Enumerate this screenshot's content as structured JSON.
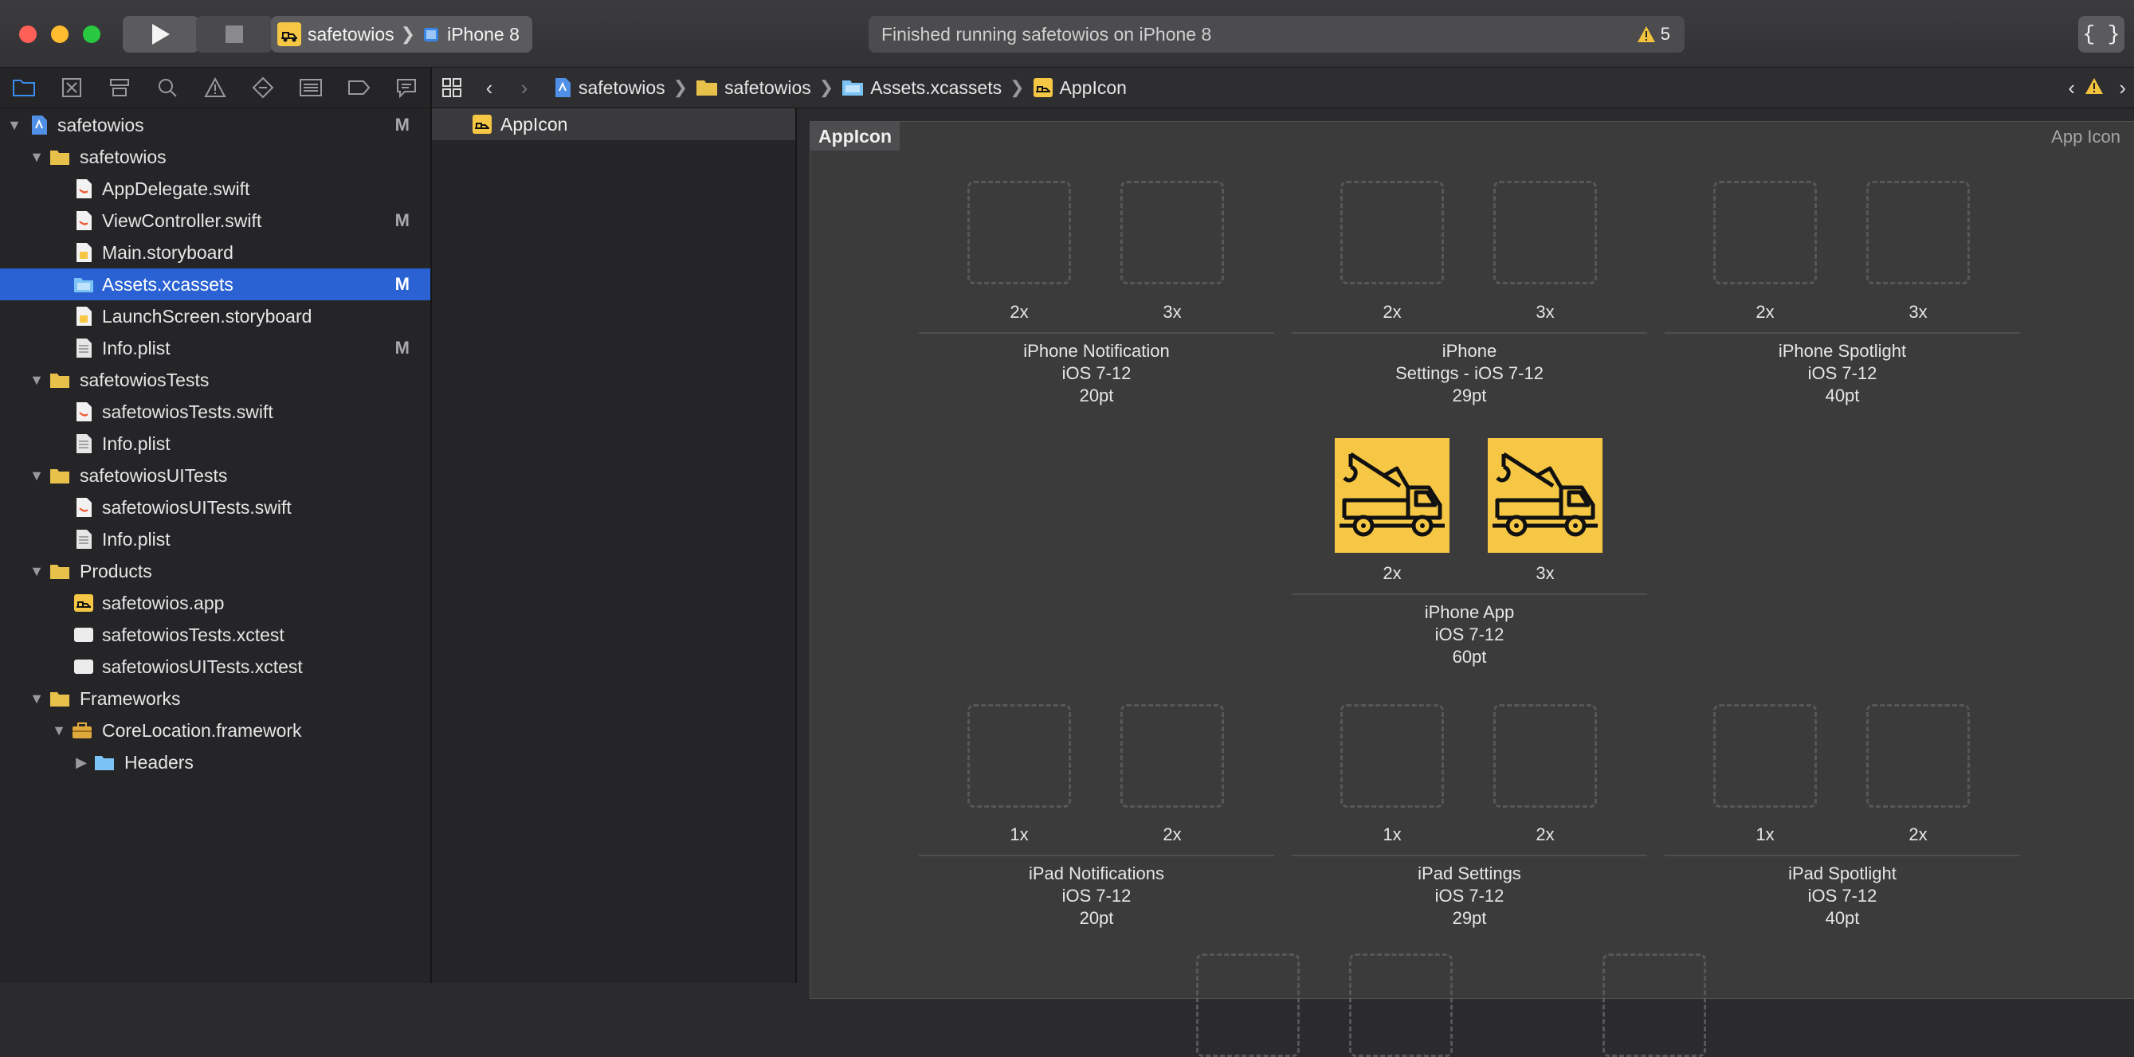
{
  "toolbar": {
    "scheme_name": "safetowios",
    "device_name": "iPhone 8",
    "activity_text": "Finished running safetowios on iPhone 8",
    "warning_count": "5"
  },
  "navigator": {
    "items": [
      {
        "label": "safetowios",
        "badge": "M"
      },
      {
        "label": "safetowios",
        "badge": ""
      },
      {
        "label": "AppDelegate.swift",
        "badge": ""
      },
      {
        "label": "ViewController.swift",
        "badge": "M"
      },
      {
        "label": "Main.storyboard",
        "badge": ""
      },
      {
        "label": "Assets.xcassets",
        "badge": "M"
      },
      {
        "label": "LaunchScreen.storyboard",
        "badge": ""
      },
      {
        "label": "Info.plist",
        "badge": "M"
      },
      {
        "label": "safetowiosTests",
        "badge": ""
      },
      {
        "label": "safetowiosTests.swift",
        "badge": ""
      },
      {
        "label": "Info.plist",
        "badge": ""
      },
      {
        "label": "safetowiosUITests",
        "badge": ""
      },
      {
        "label": "safetowiosUITests.swift",
        "badge": ""
      },
      {
        "label": "Info.plist",
        "badge": ""
      },
      {
        "label": "Products",
        "badge": ""
      },
      {
        "label": "safetowios.app",
        "badge": ""
      },
      {
        "label": "safetowiosTests.xctest",
        "badge": ""
      },
      {
        "label": "safetowiosUITests.xctest",
        "badge": ""
      },
      {
        "label": "Frameworks",
        "badge": ""
      },
      {
        "label": "CoreLocation.framework",
        "badge": ""
      },
      {
        "label": "Headers",
        "badge": ""
      }
    ]
  },
  "jumpbar": {
    "crumbs": [
      "safetowios",
      "safetowios",
      "Assets.xcassets",
      "AppIcon"
    ]
  },
  "asset_list": {
    "items": [
      "AppIcon"
    ]
  },
  "editor": {
    "set_title": "AppIcon",
    "set_type": "App Icon",
    "groups": [
      {
        "l1": "iPhone Notification",
        "l2": "iOS 7-12",
        "l3": "20pt",
        "s1": "2x",
        "s2": "3x"
      },
      {
        "l1": "iPhone",
        "l2": "Settings - iOS 7-12",
        "l3": "29pt",
        "s1": "2x",
        "s2": "3x"
      },
      {
        "l1": "iPhone Spotlight",
        "l2": "iOS 7-12",
        "l3": "40pt",
        "s1": "2x",
        "s2": "3x"
      },
      {
        "l1": "iPhone App",
        "l2": "iOS 7-12",
        "l3": "60pt",
        "s1": "2x",
        "s2": "3x"
      },
      {
        "l1": "iPad Notifications",
        "l2": "iOS 7-12",
        "l3": "20pt",
        "s1": "1x",
        "s2": "2x"
      },
      {
        "l1": "iPad Settings",
        "l2": "iOS 7-12",
        "l3": "29pt",
        "s1": "1x",
        "s2": "2x"
      },
      {
        "l1": "iPad Spotlight",
        "l2": "iOS 7-12",
        "l3": "40pt",
        "s1": "1x",
        "s2": "2x"
      }
    ]
  },
  "colors": {
    "selection": "#2a62d4",
    "icon_yellow": "#f6c744",
    "folder_yellow": "#e8c14a"
  }
}
